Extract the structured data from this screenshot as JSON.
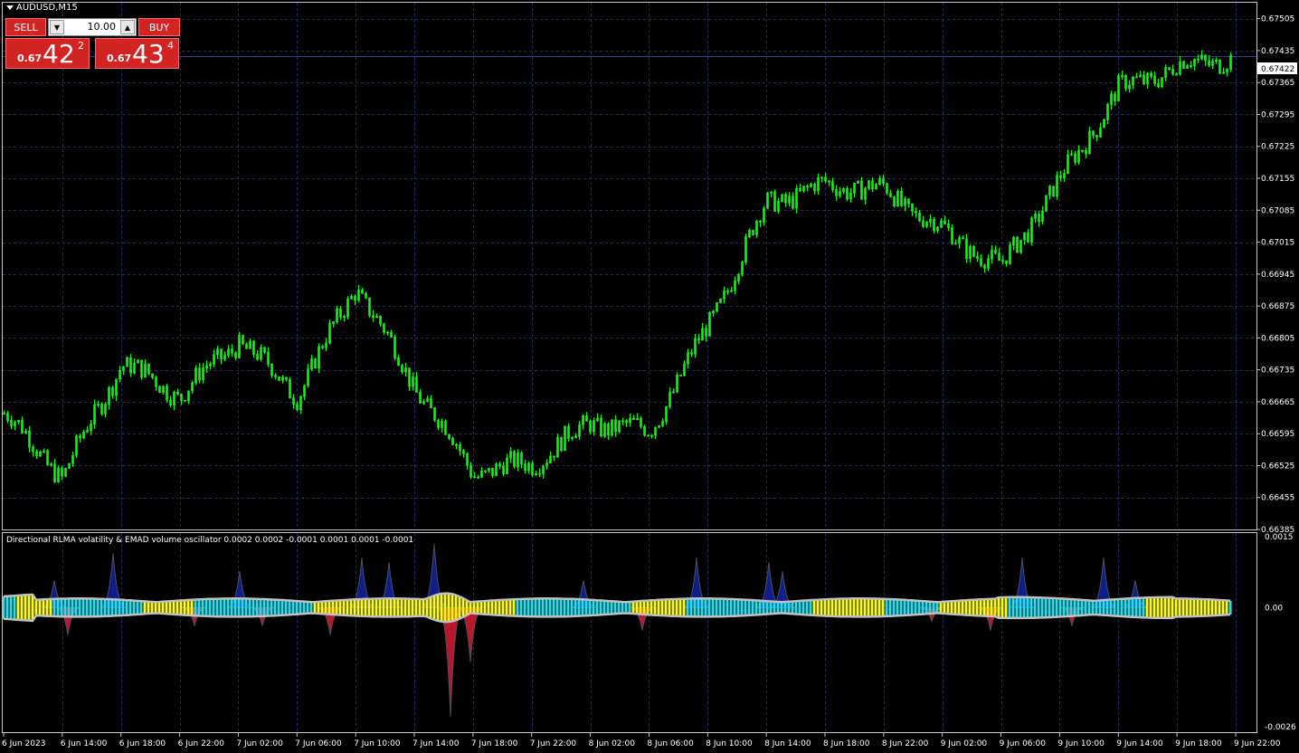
{
  "window": {
    "title": "AUDUSD,M15"
  },
  "trade_panel": {
    "sell_label": "SELL",
    "buy_label": "BUY",
    "lot_value": "10.00",
    "bid": {
      "prefix": "0.67",
      "big": "42",
      "sup": "2"
    },
    "ask": {
      "prefix": "0.67",
      "big": "43",
      "sup": "4"
    }
  },
  "colors": {
    "background": "#000000",
    "candles": "#00ff00",
    "grid": "#1c2c6c",
    "bid_line": "#2b3a8c",
    "panel_red": "#d32424",
    "osc_yellow": "#ffff00",
    "osc_cyan": "#22e0ee",
    "osc_envelope": "#c0c0c0",
    "vol_up": "#101e8a",
    "vol_down": "#b8182c"
  },
  "price_axis": {
    "labels": [
      "0.67505",
      "0.67435",
      "0.67365",
      "0.67295",
      "0.67225",
      "0.67155",
      "0.67085",
      "0.67015",
      "0.66945",
      "0.66875",
      "0.66805",
      "0.66735",
      "0.66665",
      "0.66595",
      "0.66525",
      "0.66455",
      "0.66385"
    ],
    "current_price": "0.67422"
  },
  "time_axis": {
    "labels": [
      "6 Jun 2023",
      "6 Jun 14:00",
      "6 Jun 18:00",
      "6 Jun 22:00",
      "7 Jun 02:00",
      "7 Jun 06:00",
      "7 Jun 10:00",
      "7 Jun 14:00",
      "7 Jun 18:00",
      "7 Jun 22:00",
      "8 Jun 02:00",
      "8 Jun 06:00",
      "8 Jun 10:00",
      "8 Jun 14:00",
      "8 Jun 18:00",
      "8 Jun 22:00",
      "9 Jun 02:00",
      "9 Jun 06:00",
      "9 Jun 10:00",
      "9 Jun 14:00",
      "9 Jun 18:00",
      "9 Jun 22:00"
    ]
  },
  "indicator": {
    "title": "Directional RLMA volatility & EMAD volume oscillator 0.0002 0.0002 -0.0001 0.0001 0.0001 -0.0001",
    "axis_labels": [
      "0.0015",
      "0.00",
      "-0.0026"
    ]
  },
  "chart_data": {
    "type": "line",
    "symbol": "AUDUSD",
    "timeframe": "M15",
    "x": [
      "6 Jun 2023",
      "6 Jun 14:00",
      "6 Jun 18:00",
      "6 Jun 22:00",
      "7 Jun 02:00",
      "7 Jun 06:00",
      "7 Jun 10:00",
      "7 Jun 14:00",
      "7 Jun 18:00",
      "7 Jun 22:00",
      "8 Jun 02:00",
      "8 Jun 06:00",
      "8 Jun 10:00",
      "8 Jun 14:00",
      "8 Jun 18:00",
      "8 Jun 22:00",
      "9 Jun 02:00",
      "9 Jun 06:00",
      "9 Jun 10:00",
      "9 Jun 14:00",
      "9 Jun 18:00",
      "9 Jun 22:00"
    ],
    "series": [
      {
        "values": [
          0.6664,
          0.665,
          0.6675,
          0.6668,
          0.668,
          0.6668,
          0.6692,
          0.667,
          0.6651,
          0.6653,
          0.6662,
          0.666,
          0.6683,
          0.671,
          0.6714,
          0.6713,
          0.6704,
          0.6696,
          0.6715,
          0.6735,
          0.674,
          0.67422
        ]
      }
    ],
    "ylim": [
      0.66385,
      0.6754
    ],
    "indicator_ylim": [
      -0.0026,
      0.0015
    ],
    "grid": true
  }
}
